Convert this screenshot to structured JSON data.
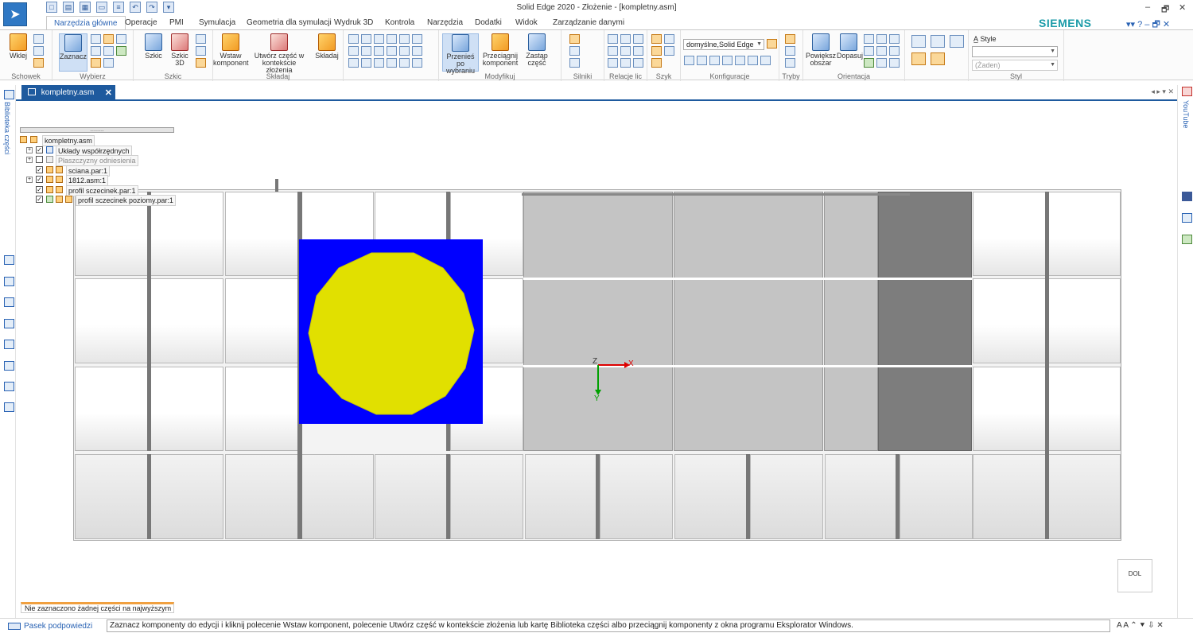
{
  "window": {
    "title": "Solid Edge 2020 - Złożenie - [kompletny.asm]",
    "minimize": "–",
    "restore": "🗗",
    "close": "✕"
  },
  "quick_access": [
    "new",
    "open",
    "save",
    "undo",
    "redo"
  ],
  "ribbon_tabs": [
    "Narzędzia główne",
    "Operacje",
    "PMI",
    "Symulacja",
    "Geometria dla symulacji",
    "Wydruk 3D",
    "Kontrola",
    "Narzędzia",
    "Dodatki",
    "Widok",
    "Zarządzanie danymi"
  ],
  "brand": "SIEMENS",
  "help_controls": "▾▾ ? – 🗗 ✕",
  "ribbon": {
    "clipboard": {
      "label": "Schowek",
      "paste": "Wklej"
    },
    "select": {
      "label": "Wybierz",
      "select_btn": "Zaznacz"
    },
    "sketch": {
      "label": "Szkic",
      "sketch_btn": "Szkic",
      "sketch3d_btn": "Szkic 3D"
    },
    "assemble": {
      "label": "Składaj",
      "insert": "Wstaw komponent",
      "create_in_context": "Utwórz część w kontekście złożenia",
      "assemble_btn": "Składaj"
    },
    "modify": {
      "label": "Modyfikuj",
      "move_selected": "Przenieś po wybraniu",
      "drag_component": "Przeciągnij komponent",
      "replace_part": "Zastąp część"
    },
    "motors": {
      "label": "Silniki"
    },
    "relations": {
      "label": "Relacje lic"
    },
    "pattern": {
      "label": "Szyk"
    },
    "configuration": {
      "label": "Konfiguracje",
      "combo_value": "domyślne,Solid Edge"
    },
    "modes": {
      "label": "Tryby"
    },
    "orientation": {
      "label": "Orientacja",
      "zoom_area": "Powiększ obszar",
      "fit": "Dopasuj"
    },
    "style": {
      "label": "Styl",
      "style_btn": "Style",
      "style_combo_value": "",
      "style_combo2_value": "(Żaden)"
    }
  },
  "document_tab": {
    "label": "kompletny.asm",
    "close": "✕",
    "nav": "◂ ▸ ▾ ✕"
  },
  "left_strip": {
    "library_label": "Biblioteka części"
  },
  "right_strip": {
    "youtube_label": "YouTube"
  },
  "pathfinder": {
    "grip": ".........",
    "nodes": [
      {
        "label": "kompletny.asm",
        "checked": false,
        "expandable": false,
        "indent": 0,
        "dim": false
      },
      {
        "label": "Układy współrzędnych",
        "checked": true,
        "expandable": true,
        "indent": 1,
        "dim": false
      },
      {
        "label": "Płaszczyzny odniesienia",
        "checked": false,
        "expandable": true,
        "indent": 1,
        "dim": true
      },
      {
        "label": "sciana.par:1",
        "checked": true,
        "expandable": false,
        "indent": 1,
        "dim": false
      },
      {
        "label": "1812.asm:1",
        "checked": true,
        "expandable": true,
        "indent": 1,
        "dim": false
      },
      {
        "label": "profil sczecinek.par:1",
        "checked": true,
        "expandable": false,
        "indent": 1,
        "dim": false
      },
      {
        "label": "profil sczecinek poziomy.par:1",
        "checked": true,
        "expandable": false,
        "indent": 1,
        "dim": false
      }
    ]
  },
  "axes": {
    "z": "Z",
    "x": "X",
    "y": "Y"
  },
  "viewcube": {
    "label": "DOL"
  },
  "status_box": "Nie zaznaczono żadnej części na najwyższym po",
  "hint_bar": {
    "label": "Pasek podpowiedzi",
    "text": "Zaznacz komponenty do edycji i kliknij polecenie Wstaw komponent, polecenie Utwórz część w kontekście złożenia lub kartę Biblioteka części albo przeciągnij komponenty z okna programu Eksplorator Windows.",
    "controls": "A A ⌃ ⯆ ⇩ ✕"
  },
  "colors": {
    "accent": "#1e5a9e",
    "part_background": "#0000ff",
    "part_circle": "#e1e000",
    "brand": "#1b9ba8"
  }
}
